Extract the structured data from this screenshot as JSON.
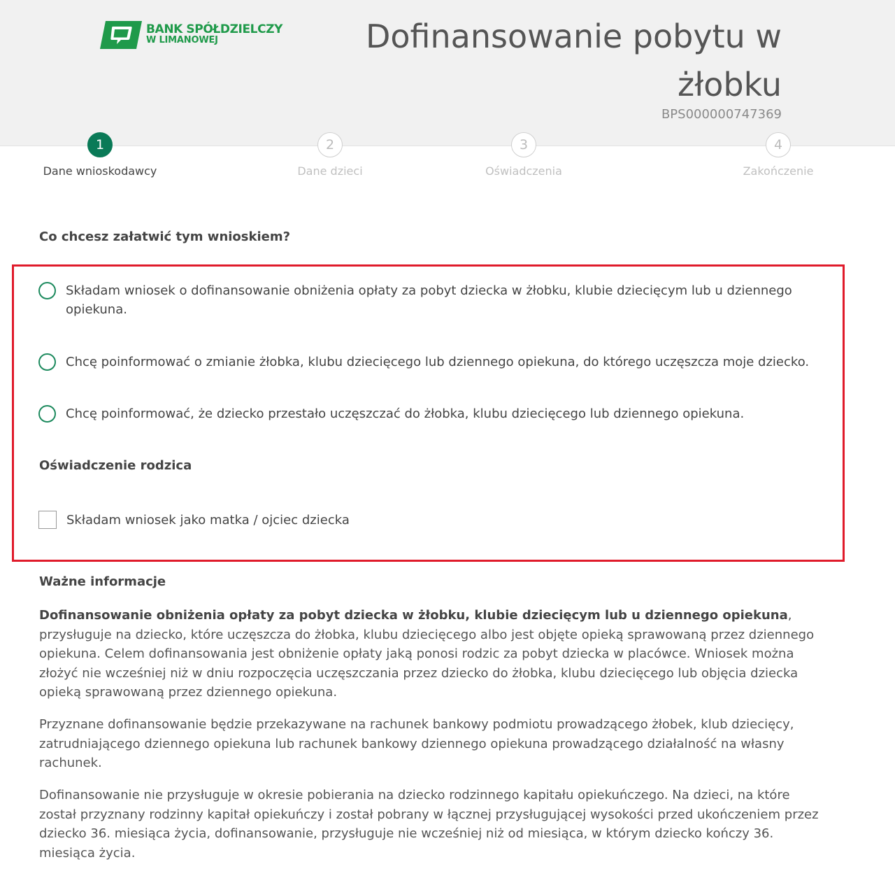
{
  "header": {
    "logo": {
      "line1": "BANK SPÓŁDZIELCZY",
      "line2": "W LIMANOWEJ",
      "color": "#1f9a4a"
    },
    "title_line1": "Dofinansowanie pobytu w",
    "title_line2": "żłobku",
    "reference_number": "BPS000000747369"
  },
  "stepper": {
    "steps": [
      {
        "number": "1",
        "label": "Dane wnioskodawcy",
        "active": true
      },
      {
        "number": "2",
        "label": "Dane dzieci",
        "active": false
      },
      {
        "number": "3",
        "label": "Oświadczenia",
        "active": false
      },
      {
        "number": "4",
        "label": "Zakończenie",
        "active": false
      }
    ],
    "active_color": "#0a7a57"
  },
  "form": {
    "question": "Co chcesz załatwić tym wnioskiem?",
    "options": [
      {
        "label": "Składam wniosek o dofinansowanie obniżenia opłaty za pobyt dziecka w żłobku, klubie dziecięcym lub u dziennego opiekuna.",
        "selected": false
      },
      {
        "label": "Chcę poinformować o zmianie żłobka, klubu dziecięcego lub dziennego opiekuna, do którego uczęszcza moje dziecko.",
        "selected": false
      },
      {
        "label": "Chcę poinformować, że dziecko przestało uczęszczać do żłobka, klubu dziecięcego lub dziennego opiekuna.",
        "selected": false
      }
    ],
    "parent_statement": {
      "heading": "Oświadczenie rodzica",
      "checkbox_label": "Składam wniosek jako matka / ojciec dziecka",
      "checked": false
    },
    "highlight_color": "#e01b2b"
  },
  "info": {
    "heading": "Ważne informacje",
    "p1_bold": "Dofinansowanie obniżenia opłaty za pobyt dziecka w żłobku, klubie dziecięcym lub u dziennego opiekuna",
    "p1_rest": ", przysługuje na dziecko, które uczęszcza do żłobka, klubu dziecięcego albo jest objęte opieką sprawowaną przez dziennego opiekuna. Celem dofinansowania jest obniżenie opłaty jaką ponosi rodzic za pobyt dziecka w placówce. Wniosek można złożyć nie wcześniej niż w dniu rozpoczęcia uczęszczania przez dziecko do żłobka, klubu dziecięcego lub objęcia dziecka opieką sprawowaną przez dziennego opiekuna.",
    "p2": "Przyznane dofinansowanie będzie przekazywane na rachunek bankowy podmiotu prowadzącego żłobek, klub dziecięcy, zatrudniającego dziennego opiekuna lub rachunek bankowy dziennego opiekuna prowadzącego działalność na własny rachunek.",
    "p3": "Dofinansowanie nie przysługuje w okresie pobierania na dziecko rodzinnego kapitału opiekuńczego. Na dzieci, na które został przyznany rodzinny kapitał opiekuńczy i został pobrany w łącznej przysługującej wysokości przed ukończeniem przez dziecko 36. miesiąca życia, dofinansowanie, przysługuje nie wcześniej niż od miesiąca, w którym dziecko kończy 36. miesiąca życia."
  }
}
